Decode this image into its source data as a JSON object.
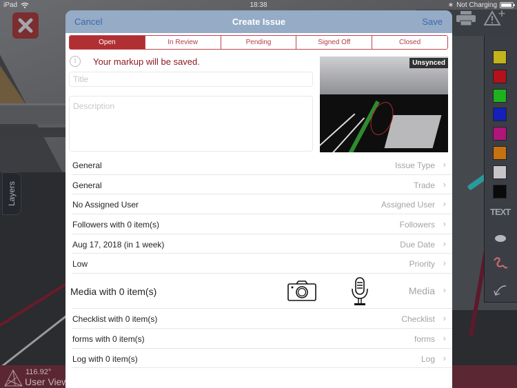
{
  "status_bar": {
    "device": "iPad",
    "time": "18:38",
    "battery_status": "Not Charging",
    "battery_level_percent": 95,
    "icons": [
      "wifi-icon",
      "bluetooth-icon",
      "battery-icon"
    ]
  },
  "background": {
    "layers_tab": "Layers",
    "user_view": {
      "angle": "116.92°",
      "label": "User View"
    },
    "toolbar_icons": [
      "close-icon",
      "print-icon",
      "add-warning-icon"
    ],
    "palette": {
      "colors": [
        "#c2b51b",
        "#b3121a",
        "#1fb21f",
        "#1420b8",
        "#b0157a",
        "#c5720f",
        "#c6c6c8",
        "#0a0a0a"
      ],
      "tools": {
        "text_label": "TEXT",
        "icons": [
          "dot-tool-icon",
          "freehand-tool-icon",
          "undo-icon"
        ]
      }
    }
  },
  "modal": {
    "cancel_label": "Cancel",
    "title": "Create Issue",
    "save_label": "Save",
    "status_tabs": [
      {
        "label": "Open",
        "active": true
      },
      {
        "label": "In Review",
        "active": false
      },
      {
        "label": "Pending",
        "active": false
      },
      {
        "label": "Signed Off",
        "active": false
      },
      {
        "label": "Closed",
        "active": false
      }
    ],
    "info_message": "Your markup will be saved.",
    "title_input": {
      "value": "",
      "placeholder": "Title"
    },
    "description_input": {
      "value": "",
      "placeholder": "Description"
    },
    "thumbnail_badge": "Unsynced",
    "fields": [
      {
        "value": "General",
        "label": "Issue Type"
      },
      {
        "value": "General",
        "label": "Trade"
      },
      {
        "value": "No Assigned User",
        "label": "Assigned User"
      },
      {
        "value": "Followers with 0 item(s)",
        "label": "Followers"
      },
      {
        "value": "Aug 17, 2018 (in 1 week)",
        "label": "Due Date"
      },
      {
        "value": "Low",
        "label": "Priority"
      }
    ],
    "media": {
      "value": "Media with 0 item(s)",
      "label": "Media",
      "icons": [
        "camera-icon",
        "microphone-icon"
      ]
    },
    "extra_fields": [
      {
        "value": "Checklist with 0 item(s)",
        "label": "Checklist"
      },
      {
        "value": "forms with 0 item(s)",
        "label": "forms"
      },
      {
        "value": "Log with 0 item(s)",
        "label": "Log"
      }
    ],
    "chevron": "›"
  },
  "colors": {
    "accent_red": "#b02f33",
    "header_blue": "#95abc6",
    "link_blue": "#3d68ad",
    "message_red": "#8b1a22"
  }
}
